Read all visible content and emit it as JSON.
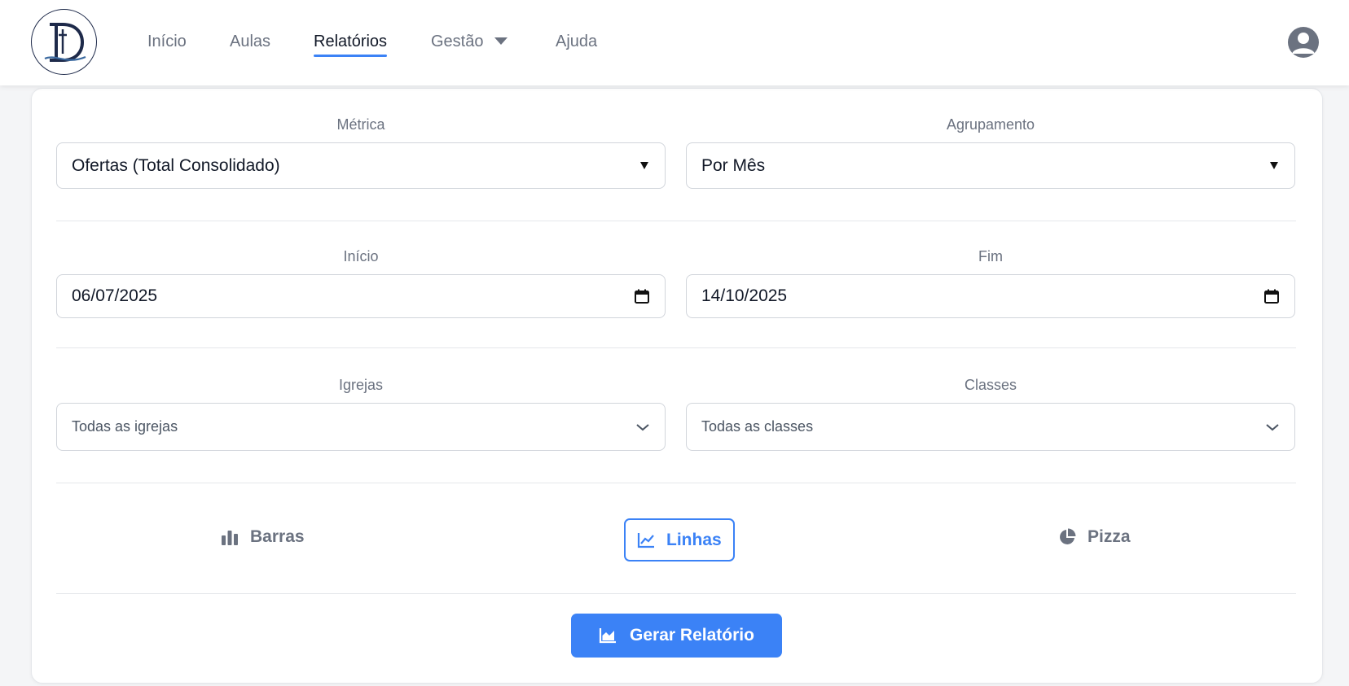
{
  "nav": {
    "items": [
      {
        "label": "Início"
      },
      {
        "label": "Aulas"
      },
      {
        "label": "Relatórios"
      },
      {
        "label": "Gestão"
      },
      {
        "label": "Ajuda"
      }
    ]
  },
  "filters": {
    "metric": {
      "label": "Métrica",
      "value": "Ofertas (Total Consolidado)"
    },
    "grouping": {
      "label": "Agrupamento",
      "value": "Por Mês"
    },
    "start": {
      "label": "Início",
      "value": "06/07/2025"
    },
    "end": {
      "label": "Fim",
      "value": "14/10/2025"
    },
    "churches": {
      "label": "Igrejas",
      "value": "Todas as igrejas"
    },
    "classes": {
      "label": "Classes",
      "value": "Todas as classes"
    }
  },
  "chart_types": {
    "bars": "Barras",
    "lines": "Linhas",
    "pie": "Pizza",
    "selected": "Linhas"
  },
  "actions": {
    "generate": "Gerar Relatório"
  },
  "colors": {
    "accent": "#3b82f6",
    "logo": "#1e2a4a",
    "muted_text": "#6b7280"
  }
}
